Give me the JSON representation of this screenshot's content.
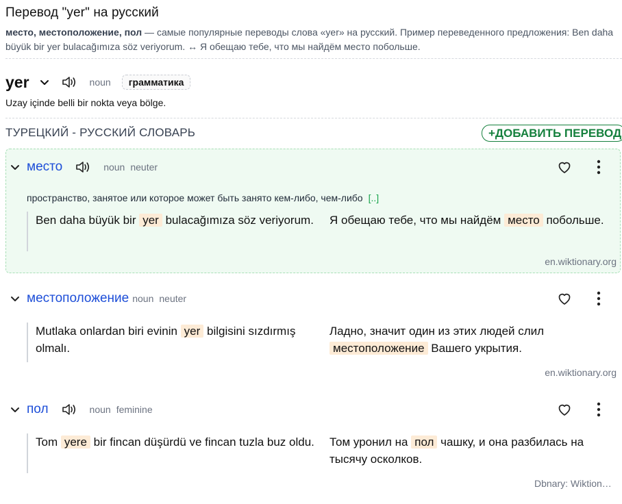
{
  "header": {
    "title": "Перевод \"yer\" на русский",
    "desc_bold": "место, местоположение, пол",
    "desc_rest": " — самые популярные переводы слова «yer» на русский. Пример переведенного предложения: Ben daha büyük bir yer bulacağımıza söz veriyorum. ↔ Я обещаю тебе, что мы найдём место побольше."
  },
  "word": {
    "text": "yer",
    "pos": "noun",
    "grammar_button": "грамматика",
    "definition": "Uzay içinde belli bir nokta veya bölge."
  },
  "dictionary": {
    "label": "ТУРЕЦКИЙ - РУССКИЙ СЛОВАРЬ",
    "add_button": "+ДОБАВИТЬ ПЕРЕВОД"
  },
  "entries": [
    {
      "word": "место",
      "pos": "noun",
      "gender": "neuter",
      "definition": "пространство, занятое или которое может быть занято кем-либо, чем-либо",
      "more": "[..]",
      "ex_src_before": "Ben daha büyük bir ",
      "ex_src_hl": "yer",
      "ex_src_after": " bulacağımıza söz veriyorum.",
      "ex_dst_before": "Я обещаю тебе, что мы найдём ",
      "ex_dst_hl": "место",
      "ex_dst_after": " побольше.",
      "source": "en.wiktionary.org"
    },
    {
      "word": "местоположение",
      "pos": "noun",
      "gender": "neuter",
      "ex_src_before": "Mutlaka onlardan biri evinin ",
      "ex_src_hl": "yer",
      "ex_src_after": " bilgisini sızdırmış olmalı.",
      "ex_dst_before": "Ладно, значит один из этих людей слил ",
      "ex_dst_hl": "местоположение",
      "ex_dst_after": " Вашего укрытия.",
      "source": "en.wiktionary.org"
    },
    {
      "word": "пол",
      "pos": "noun",
      "gender": "feminine",
      "ex_src_before": "Tom ",
      "ex_src_hl": "yere",
      "ex_src_after": " bir fincan düşürdü ve fincan tuzla buz oldu.",
      "ex_dst_before": "Том уронил на ",
      "ex_dst_hl": "пол",
      "ex_dst_after": " чашку, и она разбилась на тысячу осколков.",
      "source": "Dbnary: Wiktion…"
    }
  ],
  "icons": {
    "speaker": "speaker-icon",
    "chevron": "chevron-down-icon",
    "heart": "heart-outline-icon",
    "more": "more-vertical-icon"
  },
  "colors": {
    "link_blue": "#1d4ed8",
    "green": "#15803d",
    "highlight": "#fdebd6",
    "card_bg": "#effaf2"
  }
}
